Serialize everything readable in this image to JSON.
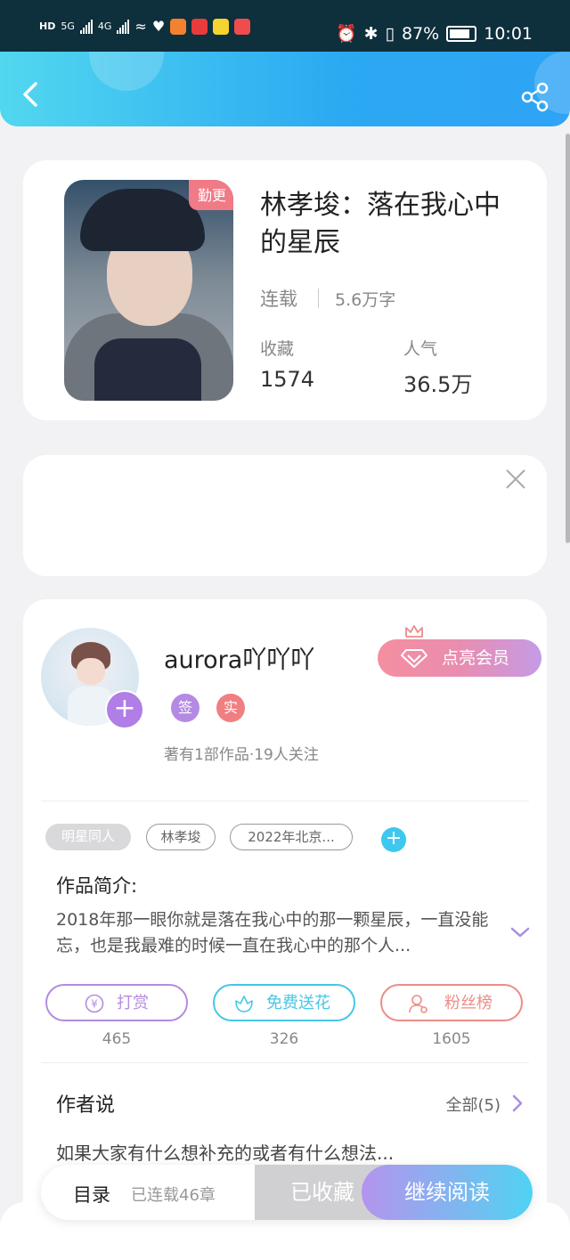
{
  "status_bar": {
    "network_left": "HD",
    "net_gen_1": "5G",
    "net_gen_2": "4G",
    "battery": "87%",
    "time": "10:01"
  },
  "book": {
    "badge": "勤更",
    "title": "林孝埈：落在我心中的星辰",
    "status": "连载",
    "words": "5.6万字",
    "favorites_label": "收藏",
    "favorites_value": "1574",
    "popularity_label": "人气",
    "popularity_value": "36.5万"
  },
  "author": {
    "name": "aurora吖吖吖",
    "tag_signed": "签",
    "tag_real": "实",
    "info": "著有1部作品·19人关注",
    "vip_button": "点亮会员"
  },
  "tags": [
    "明星同人",
    "林孝埈",
    "2022年北京..."
  ],
  "intro": {
    "label": "作品简介:",
    "text": "2018年那一眼你就是落在我心中的那一颗星辰，一直没能忘，也是我最难的时候一直在我心中的那个人..."
  },
  "actions": [
    {
      "label": "打赏",
      "count": "465",
      "color": "#b48be0"
    },
    {
      "label": "免费送花",
      "count": "326",
      "color": "#45c6e8"
    },
    {
      "label": "粉丝榜",
      "count": "1605",
      "color": "#ec8d88"
    }
  ],
  "author_says": {
    "label": "作者说",
    "all": "全部(5)",
    "text": "如果大家有什么想补充的或者有什么想法..."
  },
  "bottom_bar": {
    "toc": "目录",
    "serial": "已连载46章",
    "collected": "已收藏",
    "continue": "继续阅读"
  },
  "colors": {
    "header_start": "#52d7ef",
    "header_end": "#2fa3f4",
    "badge": "#f07a86",
    "purple": "#b07ee6",
    "cyan": "#3ec8ef"
  }
}
